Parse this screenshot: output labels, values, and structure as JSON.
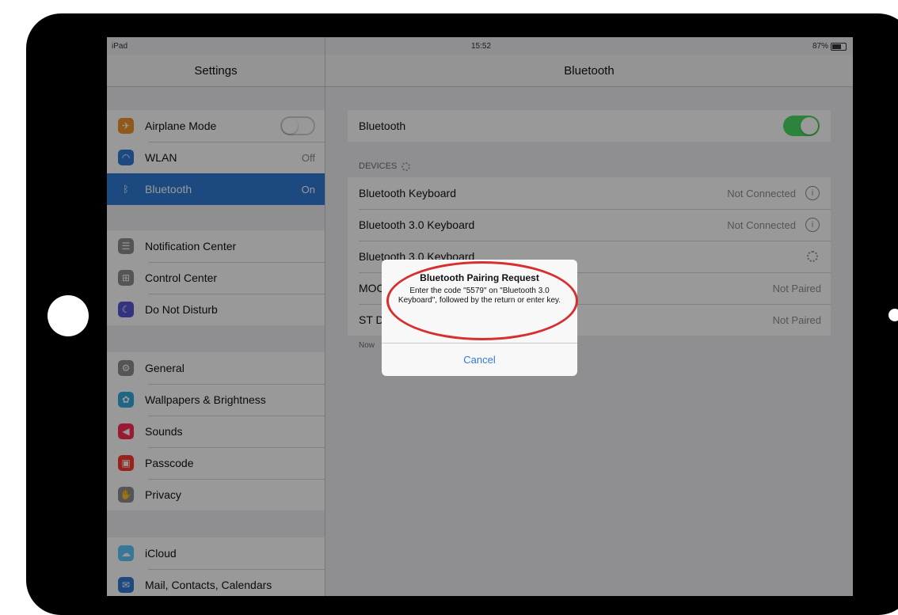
{
  "status_bar": {
    "carrier": "iPad",
    "time": "15:52",
    "battery": "87%"
  },
  "left_pane": {
    "title": "Settings",
    "groups": [
      {
        "items": [
          {
            "label": "Airplane Mode",
            "icon": "airplane-icon",
            "color": "#f0952a",
            "control": "toggle-off"
          },
          {
            "label": "WLAN",
            "icon": "wifi-icon",
            "color": "#2f7bd6",
            "value": "Off"
          },
          {
            "label": "Bluetooth",
            "icon": "bluetooth-icon",
            "color": "#2f7bd6",
            "value": "On",
            "selected": true
          }
        ]
      },
      {
        "items": [
          {
            "label": "Notification Center",
            "icon": "notification-center-icon",
            "color": "#8e8e93"
          },
          {
            "label": "Control Center",
            "icon": "control-center-icon",
            "color": "#8e8e93"
          },
          {
            "label": "Do Not Disturb",
            "icon": "moon-icon",
            "color": "#5856d6"
          }
        ]
      },
      {
        "items": [
          {
            "label": "General",
            "icon": "gear-icon",
            "color": "#8e8e93"
          },
          {
            "label": "Wallpapers & Brightness",
            "icon": "wallpaper-icon",
            "color": "#34aadc"
          },
          {
            "label": "Sounds",
            "icon": "speaker-icon",
            "color": "#ff2d55"
          },
          {
            "label": "Passcode",
            "icon": "lock-icon",
            "color": "#ff3b30"
          },
          {
            "label": "Privacy",
            "icon": "hand-icon",
            "color": "#8e8e93"
          }
        ]
      },
      {
        "items": [
          {
            "label": "iCloud",
            "icon": "cloud-icon",
            "color": "#5ac8fa"
          },
          {
            "label": "Mail, Contacts, Calendars",
            "icon": "mail-icon",
            "color": "#2f7bd6"
          }
        ]
      }
    ]
  },
  "right_pane": {
    "title": "Bluetooth",
    "bluetooth_label": "Bluetooth",
    "bluetooth_on": true,
    "devices_header": "DEVICES",
    "devices": [
      {
        "name": "Bluetooth Keyboard",
        "status": "Not Connected",
        "icon": "info-icon"
      },
      {
        "name": "Bluetooth 3.0 Keyboard",
        "status": "Not Connected",
        "icon": "info-icon"
      },
      {
        "name": "Bluetooth 3.0 Keyboard",
        "status": "",
        "icon": "spinner-icon"
      },
      {
        "name": "MOC",
        "status": "Not Paired",
        "icon": ""
      },
      {
        "name": "ST D",
        "status": "Not Paired",
        "icon": ""
      }
    ],
    "footer": "Now"
  },
  "alert": {
    "title": "Bluetooth Pairing Request",
    "message": "Enter the code \"5579\" on \"Bluetooth 3.0 Keyboard\", followed by the return or enter key.",
    "cancel_label": "Cancel",
    "highlight_color": "#d62f2f"
  }
}
